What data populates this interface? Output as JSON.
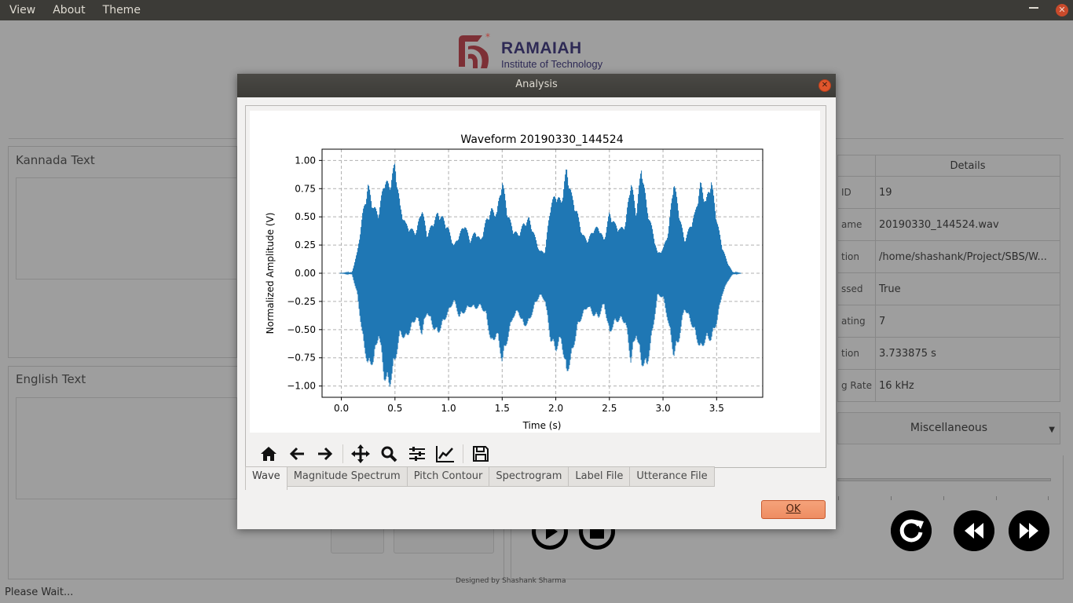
{
  "menubar": {
    "items": [
      "View",
      "About",
      "Theme"
    ]
  },
  "logo": {
    "title": "RAMAIAH",
    "subtitle": "Institute of Technology"
  },
  "panels": {
    "kannada_title": "Kannada Text",
    "english_title": "English Text"
  },
  "details": {
    "header": "Details",
    "rows": [
      {
        "key": "ID",
        "value": "19"
      },
      {
        "key": "ame",
        "value": "20190330_144524.wav"
      },
      {
        "key": "tion",
        "value": "/home/shashank/Project/SBS/W..."
      },
      {
        "key": "ssed",
        "value": "True"
      },
      {
        "key": "ating",
        "value": "7"
      },
      {
        "key": "tion",
        "value": "3.733875 s"
      },
      {
        "key": "g Rate",
        "value": "16 kHz"
      }
    ]
  },
  "combo": {
    "selected": "Miscellaneous"
  },
  "footer": "Designed by Shashank Sharma",
  "status": "Please Wait...",
  "dialog": {
    "title": "Analysis",
    "ok_label": "OK",
    "tabs": [
      "Wave",
      "Magnitude Spectrum",
      "Pitch Contour",
      "Spectrogram",
      "Label File",
      "Utterance File"
    ],
    "active_tab": "Wave",
    "toolbar_icons": [
      "home-icon",
      "back-arrow-icon",
      "forward-arrow-icon",
      "pan-icon",
      "zoom-icon",
      "subplots-icon",
      "edit-axis-icon",
      "save-icon"
    ]
  },
  "chart_data": {
    "type": "line",
    "title": "Waveform 20190330_144524",
    "xlabel": "Time (s)",
    "ylabel": "Normalized Amplitude (V)",
    "xlim": [
      -0.18,
      3.93
    ],
    "ylim": [
      -1.1,
      1.1
    ],
    "x_ticks": [
      "0.0",
      "0.5",
      "1.0",
      "1.5",
      "2.0",
      "2.5",
      "3.0",
      "3.5"
    ],
    "y_ticks": [
      "1.00",
      "0.75",
      "0.50",
      "0.25",
      "0.00",
      "−0.25",
      "−0.50",
      "−0.75",
      "−1.00"
    ],
    "grid": true,
    "color": "#1f77b4",
    "envelope": {
      "x": [
        0.0,
        0.1,
        0.15,
        0.2,
        0.25,
        0.3,
        0.35,
        0.4,
        0.45,
        0.5,
        0.55,
        0.6,
        0.65,
        0.7,
        0.75,
        0.8,
        0.85,
        0.9,
        0.95,
        1.0,
        1.05,
        1.1,
        1.15,
        1.2,
        1.25,
        1.3,
        1.35,
        1.4,
        1.45,
        1.5,
        1.55,
        1.6,
        1.65,
        1.7,
        1.75,
        1.8,
        1.85,
        1.9,
        1.95,
        2.0,
        2.05,
        2.1,
        2.15,
        2.2,
        2.25,
        2.3,
        2.35,
        2.4,
        2.45,
        2.5,
        2.55,
        2.6,
        2.65,
        2.7,
        2.75,
        2.8,
        2.85,
        2.9,
        2.95,
        3.0,
        3.05,
        3.1,
        3.15,
        3.2,
        3.25,
        3.3,
        3.35,
        3.4,
        3.45,
        3.5,
        3.55,
        3.6,
        3.65,
        3.73
      ],
      "upper": [
        0.0,
        0.01,
        0.2,
        0.55,
        0.8,
        0.6,
        0.55,
        0.85,
        0.8,
        1.0,
        0.6,
        0.45,
        0.4,
        0.38,
        0.6,
        0.35,
        0.45,
        0.55,
        0.5,
        0.4,
        0.25,
        0.35,
        0.45,
        0.3,
        0.38,
        0.3,
        0.48,
        0.58,
        0.55,
        0.85,
        0.55,
        0.4,
        0.35,
        0.45,
        0.5,
        0.35,
        0.2,
        0.2,
        0.62,
        0.72,
        0.65,
        0.95,
        0.7,
        0.55,
        0.35,
        0.3,
        0.4,
        0.42,
        0.3,
        0.55,
        0.45,
        0.4,
        0.45,
        0.85,
        0.55,
        0.98,
        0.6,
        0.4,
        0.18,
        0.22,
        0.38,
        0.85,
        0.55,
        0.3,
        0.42,
        0.55,
        0.82,
        0.65,
        0.85,
        0.5,
        0.25,
        0.1,
        0.01,
        0.0
      ],
      "lower": [
        0.0,
        -0.01,
        -0.2,
        -0.6,
        -0.85,
        -0.8,
        -0.55,
        -0.95,
        -1.02,
        -0.8,
        -0.55,
        -0.6,
        -0.5,
        -0.4,
        -0.55,
        -0.35,
        -0.48,
        -0.55,
        -0.45,
        -0.35,
        -0.25,
        -0.4,
        -0.35,
        -0.3,
        -0.32,
        -0.3,
        -0.38,
        -0.65,
        -0.55,
        -0.8,
        -0.6,
        -0.4,
        -0.35,
        -0.48,
        -0.45,
        -0.3,
        -0.2,
        -0.25,
        -0.6,
        -0.7,
        -0.6,
        -0.92,
        -0.75,
        -0.5,
        -0.38,
        -0.3,
        -0.38,
        -0.4,
        -0.28,
        -0.55,
        -0.45,
        -0.42,
        -0.45,
        -0.8,
        -0.55,
        -0.82,
        -0.85,
        -0.55,
        -0.2,
        -0.22,
        -0.45,
        -0.75,
        -0.6,
        -0.32,
        -0.42,
        -0.55,
        -0.7,
        -0.6,
        -0.6,
        -0.45,
        -0.2,
        -0.08,
        -0.01,
        0.0
      ]
    }
  }
}
